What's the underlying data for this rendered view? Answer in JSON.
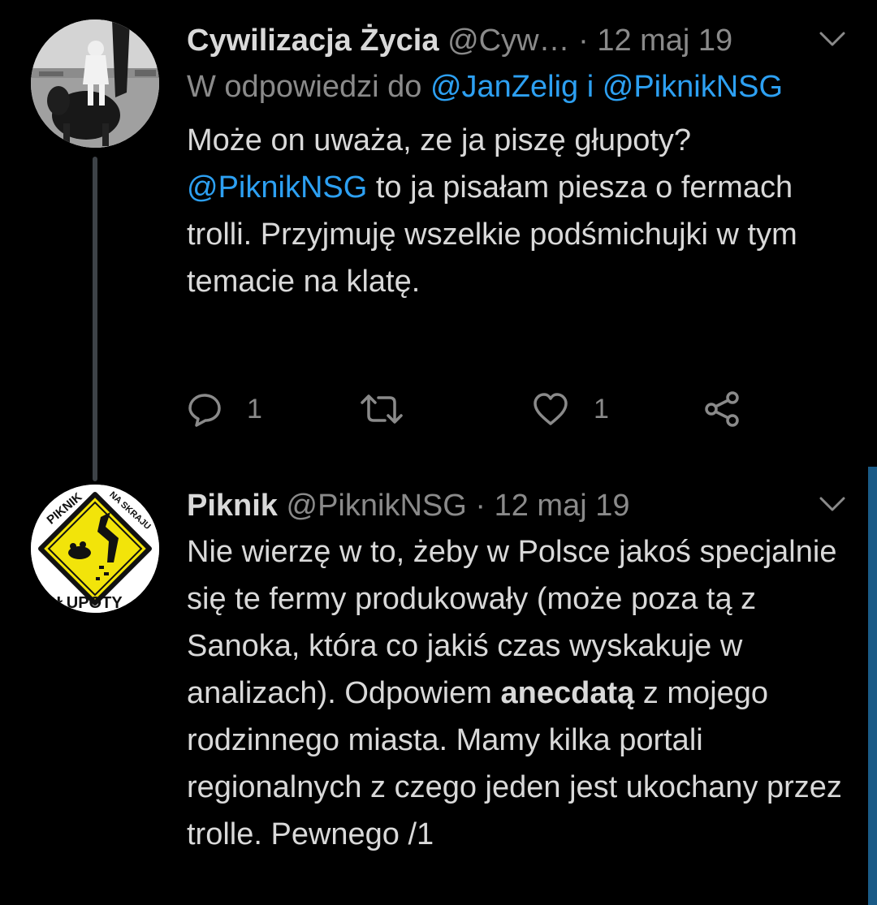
{
  "colors": {
    "background": "#000000",
    "text": "#d9d9d9",
    "muted": "#8a8a8a",
    "mention": "#2da0f2",
    "thread_line": "#3d4247",
    "scrollbar": "#1a5a86"
  },
  "tweets": [
    {
      "author_name": "Cywilizacja Życia",
      "author_handle": "@Cyw…",
      "separator": "·",
      "date": "12 maj 19",
      "reply_prefix": "W odpowiedzi do",
      "reply_mention_1": "@JanZelig",
      "reply_joiner": "i",
      "reply_mention_2": "@PiknikNSG",
      "body_line1": "Może on uważa, ze ja piszę głupoty?",
      "body_mention": "@PiknikNSG",
      "body_rest": "to ja pisałam piesza o fermach trolli. Przyjmuję wszelkie podśmichujki w tym temacie na klatę.",
      "reply_count": "1",
      "like_count": "1",
      "icons": [
        "chevron-down-icon",
        "reply-icon",
        "retweet-icon",
        "like-icon",
        "share-icon"
      ]
    },
    {
      "author_name": "Piknik",
      "author_handle": "@PiknikNSG",
      "separator": "·",
      "date": "12 maj 19",
      "body_part1": "Nie wierzę w to, żeby w Polsce jakoś specjalnie się te fermy produkowały (może poza tą z Sanoka, która co jakiś czas wyskakuje w analizach). Odpowiem",
      "body_bold": "anecdatą",
      "body_part2": "z mojego rodzinnego miasta. Mamy kilka portali regionalnych z czego jeden jest ukochany przez trolle. Pewnego /1",
      "avatar_text_top": "PIKNIK",
      "avatar_text_arc": "NA SKRAJU",
      "avatar_text_bottom": "GŁUPOTY",
      "icons": [
        "chevron-down-icon"
      ]
    }
  ]
}
